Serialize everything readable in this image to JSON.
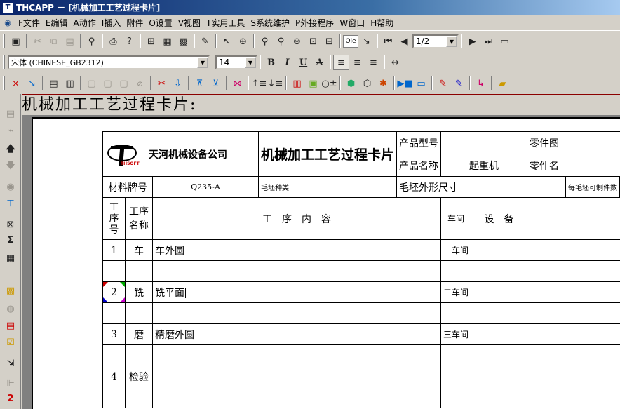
{
  "window": {
    "title": "THCAPP － [机械加工工艺过程卡片]",
    "icon": "app-icon"
  },
  "menu": [
    {
      "key": "F",
      "label": "文件"
    },
    {
      "key": "E",
      "label": "编辑"
    },
    {
      "key": "A",
      "label": "动作"
    },
    {
      "key": "I",
      "label": "插入"
    },
    {
      "key": "",
      "label": "附件"
    },
    {
      "key": "O",
      "label": "设置"
    },
    {
      "key": "V",
      "label": "视图"
    },
    {
      "key": "T",
      "label": "实用工具"
    },
    {
      "key": "S",
      "label": "系统维护"
    },
    {
      "key": "P",
      "label": "外接程序"
    },
    {
      "key": "W",
      "label": "窗口"
    },
    {
      "key": "H",
      "label": "帮助"
    }
  ],
  "toolbar1": {
    "page_combo": "1/2",
    "ole_label": "Ole"
  },
  "toolbar2": {
    "font_combo": "宋体 (CHINESE_GB2312)",
    "size_combo": "14",
    "bold": "B",
    "italic": "I",
    "underline": "U",
    "strike": "A"
  },
  "document": {
    "heading": "机械加工工艺过程卡片:"
  },
  "card": {
    "company": "天河机械设备公司",
    "logo_text": "THSOFT",
    "title": "机械加工工艺过程卡片",
    "product_model_label": "产品型号",
    "product_model_value": "",
    "product_name_label": "产品名称",
    "product_name_value": "起重机",
    "part_no_label": "零件图",
    "part_name_label": "零件名",
    "material_label": "材料牌号",
    "material_value": "Q235-A",
    "blank_type_label": "毛坯种类",
    "blank_type_value": "",
    "blank_size_label": "毛坯外形尺寸",
    "blank_size_value": "",
    "per_blank_label": "每毛坯可制件数",
    "col_no": "工\n序\n号",
    "col_name": "工序\n名称",
    "col_content": "工　序　内　容",
    "col_workshop": "车间",
    "col_equipment": "设　备",
    "rows": [
      {
        "no": "1",
        "name": "车",
        "content": "车外圆",
        "workshop": "一车间"
      },
      {
        "no": "",
        "name": "",
        "content": "",
        "workshop": ""
      },
      {
        "no": "2",
        "name": "铣",
        "content": "铣平面",
        "workshop": "二车间"
      },
      {
        "no": "",
        "name": "",
        "content": "",
        "workshop": ""
      },
      {
        "no": "3",
        "name": "磨",
        "content": "精磨外圆",
        "workshop": "三车间"
      },
      {
        "no": "",
        "name": "",
        "content": "",
        "workshop": ""
      },
      {
        "no": "4",
        "name": "检验",
        "content": "",
        "workshop": ""
      },
      {
        "no": "",
        "name": "",
        "content": "",
        "workshop": ""
      }
    ]
  },
  "leftbar": {
    "page_indicator": "2"
  }
}
